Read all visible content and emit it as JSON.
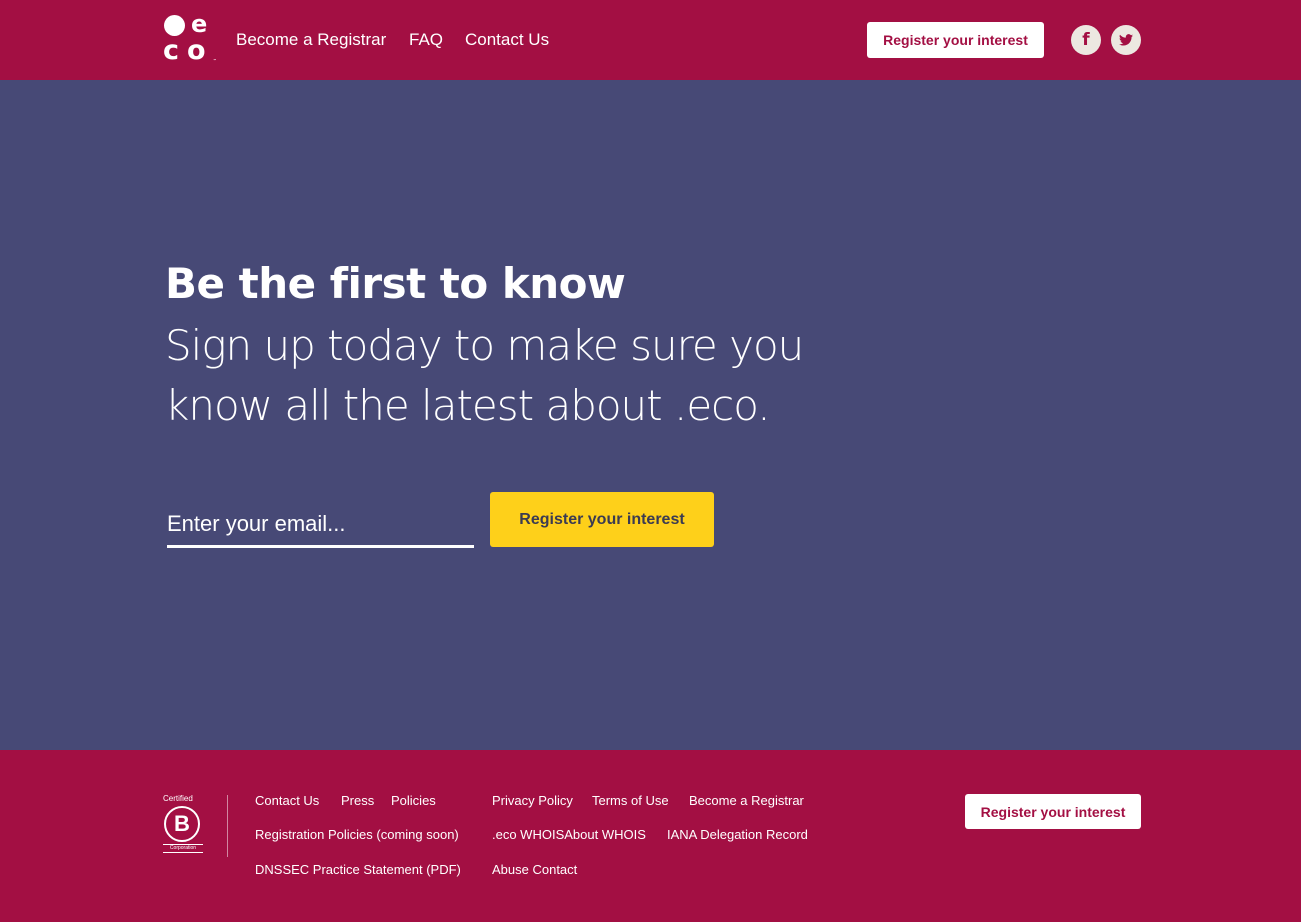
{
  "brand": {
    "logo_letters": [
      "e",
      "c",
      "o"
    ],
    "trademark": "™",
    "primary_color": "#a30f43",
    "hero_color": "#474976",
    "accent_color": "#fed01a"
  },
  "header": {
    "nav": [
      {
        "label": "Become a Registrar"
      },
      {
        "label": "FAQ"
      },
      {
        "label": "Contact Us"
      }
    ],
    "cta_label": "Register your interest",
    "social": [
      {
        "icon": "facebook-icon",
        "glyph": "f"
      },
      {
        "icon": "twitter-icon"
      }
    ]
  },
  "hero": {
    "title": "Be the first to know",
    "subtitle": "Sign up today to make sure you know all the latest about .eco.",
    "email_placeholder": "Enter your email...",
    "email_value": "",
    "cta_label": "Register your interest"
  },
  "footer": {
    "bcorp": {
      "certified": "Certified",
      "letter": "B",
      "corporation": "Corporation"
    },
    "links_col1": [
      "Contact Us",
      "Press",
      "Policies",
      "Registration Policies (coming soon)",
      "DNSSEC Practice Statement (PDF)"
    ],
    "links_col2": [
      "Privacy Policy",
      "Terms of Use",
      "Become a Registrar",
      ".eco WHOISAbout WHOIS",
      "IANA Delegation Record",
      "Abuse Contact"
    ],
    "cta_label": "Register your interest"
  }
}
